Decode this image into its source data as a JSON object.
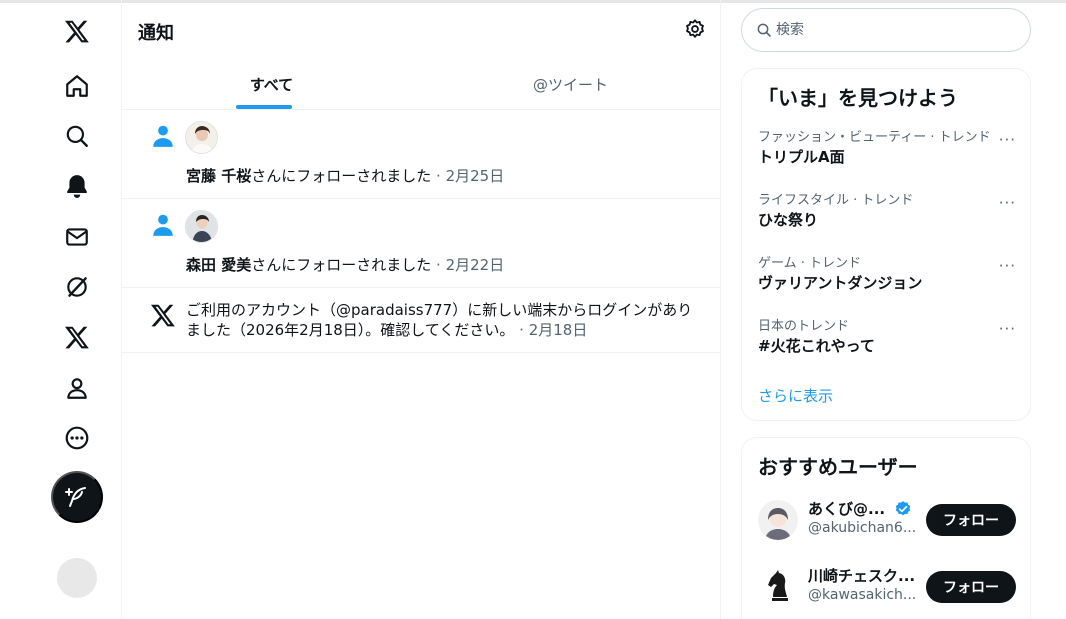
{
  "nav": {
    "items": [
      {
        "name": "x-logo-icon"
      },
      {
        "name": "home-icon"
      },
      {
        "name": "explore-icon"
      },
      {
        "name": "notifications-icon"
      },
      {
        "name": "messages-icon"
      },
      {
        "name": "grok-icon"
      },
      {
        "name": "premium-x-icon"
      },
      {
        "name": "profile-icon"
      },
      {
        "name": "more-icon"
      }
    ]
  },
  "main": {
    "title": "通知",
    "tabs": [
      {
        "label": "すべて",
        "active": true
      },
      {
        "label": "@ツイート",
        "active": false
      }
    ],
    "notifications": [
      {
        "name_family": "宮藤",
        "name_given": "千桜",
        "text": "さんにフォローされました",
        "date": " · 2月25日"
      },
      {
        "name_family": "森田",
        "name_given": "愛美",
        "text": "さんにフォローされました",
        "date": " · 2月22日"
      },
      {
        "text": "ご利用のアカウント（@paradaiss777）に新しい端末からログインがありました（2026年2月18日）。確認してください。",
        "date": " · 2月18日"
      }
    ]
  },
  "search": {
    "placeholder": "検索"
  },
  "trends": {
    "title": "「いま」を見つけよう",
    "items": [
      {
        "category": "ファッション・ビューティー · トレンド",
        "name": "トリプルA面"
      },
      {
        "category": "ライフスタイル · トレンド",
        "name": "ひな祭り"
      },
      {
        "category": "ゲーム · トレンド",
        "name": "ヴァリアントダンジョン"
      },
      {
        "category": "日本のトレンド",
        "name": "#火花これやって"
      }
    ],
    "more_glyph": "···",
    "show_more": "さらに表示"
  },
  "suggestions": {
    "title": "おすすめユーザー",
    "users": [
      {
        "name": "あくび@...",
        "handle": "@akubichan6...",
        "verified": true,
        "follow_label": "フォロー"
      },
      {
        "name": "川崎チェスク...",
        "handle": "@kawasakich...",
        "verified": false,
        "follow_label": "フォロー"
      }
    ]
  },
  "colors": {
    "accent": "#1d9bf0",
    "text": "#0f1419",
    "muted": "#536471",
    "border": "#eff3f4"
  }
}
